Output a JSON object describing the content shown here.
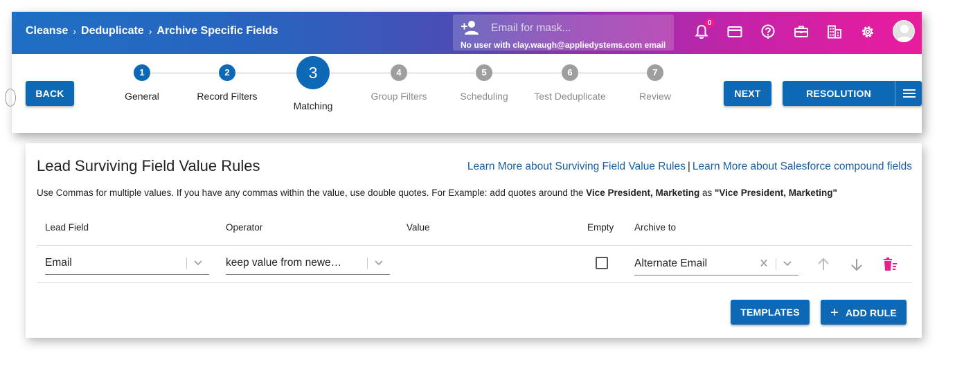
{
  "breadcrumb": [
    "Cleanse",
    "Deduplicate",
    "Archive Specific Fields"
  ],
  "breadcrumb_separator": "›",
  "mask": {
    "placeholder": "Email for mask...",
    "note": "No user with clay.waugh@appliedystems.com email"
  },
  "notifications_count": "0",
  "header_icons": [
    "bell-icon",
    "credit-card-icon",
    "help-icon",
    "briefcase-icon",
    "building-icon",
    "gear-icon",
    "avatar"
  ],
  "nav": {
    "back": "BACK",
    "next": "NEXT",
    "resolution": "RESOLUTION"
  },
  "steps": [
    {
      "num": "1",
      "label": "General",
      "state": "done"
    },
    {
      "num": "2",
      "label": "Record Filters",
      "state": "done"
    },
    {
      "num": "3",
      "label": "Matching",
      "state": "active"
    },
    {
      "num": "4",
      "label": "Group Filters",
      "state": "todo"
    },
    {
      "num": "5",
      "label": "Scheduling",
      "state": "todo"
    },
    {
      "num": "6",
      "label": "Test Deduplicate",
      "state": "todo"
    },
    {
      "num": "7",
      "label": "Review",
      "state": "todo"
    }
  ],
  "card": {
    "title": "Lead Surviving Field Value Rules",
    "link1": "Learn More about Surviving Field Value Rules",
    "link_sep": "|",
    "link2": "Learn More about Salesforce compound fields",
    "hint_a": "Use Commas for multiple values. If you have any commas within the value, use double quotes. For Example: add quotes around the ",
    "hint_b": "Vice President, Marketing",
    "hint_c": " as ",
    "hint_d": "\"Vice President, Marketing\"",
    "columns": {
      "field": "Lead Field",
      "operator": "Operator",
      "value": "Value",
      "empty": "Empty",
      "archive": "Archive to"
    },
    "row": {
      "field": "Email",
      "operator": "keep value from newe…",
      "value": "",
      "empty": false,
      "archive": "Alternate Email"
    },
    "templates": "TEMPLATES",
    "add_rule": "ADD RULE",
    "add_rule_plus": "+"
  },
  "colors": {
    "primary": "#0d68b5",
    "accent": "#e91e8c",
    "gradient_start": "#1e6fc4",
    "gradient_end": "#ea1c9e"
  }
}
